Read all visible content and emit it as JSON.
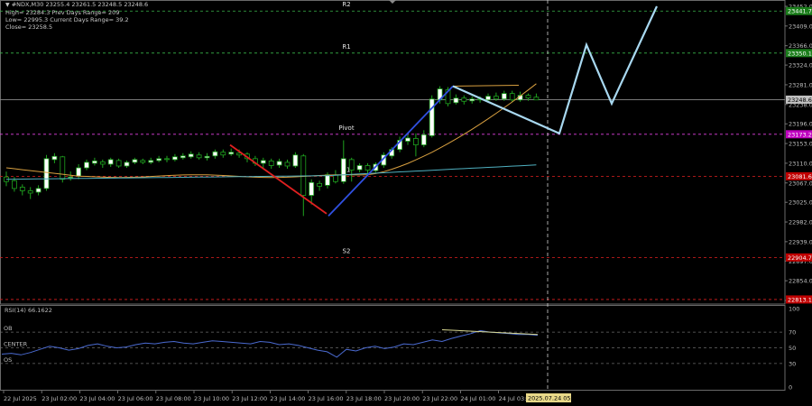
{
  "header": {
    "symbol_line": "#NDX,M30  23255.4 23261.5 23248.5 23248.6",
    "high_line": "High= 23284.3    Prev Days Range= 209",
    "low_line": "Low= 22995.3    Current Days Range= 39.2",
    "close_line": "Close= 23258.5"
  },
  "levels": {
    "R2": "R2",
    "R1": "R1",
    "Pivot": "Pivot",
    "S1": "S1",
    "S2": "S2"
  },
  "price_axis": {
    "ticks": [
      "23452.0",
      "23409.0",
      "23366.0",
      "23324.0",
      "23281.0",
      "23238.0",
      "23196.0",
      "23153.0",
      "23110.0",
      "23067.0",
      "23025.0",
      "22982.0",
      "22939.0",
      "22897.0",
      "22854.0",
      "22811.0"
    ],
    "tags": [
      {
        "text": "23441.7",
        "bg": "#1a7d1a",
        "fg": "#ffffff"
      },
      {
        "text": "23350.1",
        "bg": "#1a7d1a",
        "fg": "#ffffff"
      },
      {
        "text": "23248.6",
        "bg": "#c0c0c0",
        "fg": "#000000"
      },
      {
        "text": "23173.2",
        "bg": "#c000c0",
        "fg": "#ffffff"
      },
      {
        "text": "23081.6",
        "bg": "#c00000",
        "fg": "#ffffff"
      },
      {
        "text": "22904.7",
        "bg": "#c00000",
        "fg": "#ffffff"
      },
      {
        "text": "22813.1",
        "bg": "#c00000",
        "fg": "#ffffff"
      }
    ]
  },
  "rsi": {
    "title": "RSI(14) 66.1622",
    "ob": "OB",
    "center": "CENTER",
    "os": "OS",
    "ticks": [
      "100",
      "70",
      "50",
      "30",
      "0"
    ],
    "values": [
      42,
      43,
      41,
      44,
      48,
      52,
      50,
      47,
      49,
      53,
      55,
      52,
      50,
      51,
      54,
      56,
      55,
      57,
      58,
      56,
      55,
      57,
      59,
      58,
      57,
      56,
      55,
      58,
      57,
      54,
      55,
      53,
      50,
      47,
      45,
      38,
      48,
      46,
      50,
      52,
      49,
      51,
      55,
      54,
      57,
      60,
      58,
      62,
      65,
      68,
      72,
      70,
      69,
      68,
      67,
      67,
      66
    ]
  },
  "time_axis": {
    "labels": [
      "22 Jul 2025",
      "23 Jul 02:00",
      "23 Jul 04:00",
      "23 Jul 06:00",
      "23 Jul 08:00",
      "23 Jul 10:00",
      "23 Jul 12:00",
      "23 Jul 14:00",
      "23 Jul 16:00",
      "23 Jul 18:00",
      "23 Jul 20:00",
      "23 Jul 22:00",
      "24 Jul 01:00",
      "24 Jul 03:00"
    ],
    "cursor_label": "2025.07.24 05:30"
  },
  "colors": {
    "background": "#000000",
    "bull": "#ffffff",
    "bear": "#000000",
    "wick": "#1fa31f",
    "level_green": "#39b54a",
    "level_red": "#e02020",
    "pivot": "#e040e0",
    "projection": "#a8d8f0",
    "trend_red": "#e02020",
    "trend_blue": "#3050e0",
    "ma_orange": "#d9a040",
    "ma_teal": "#4fb0c0",
    "rsi_line": "#4a6ad0"
  }
}
